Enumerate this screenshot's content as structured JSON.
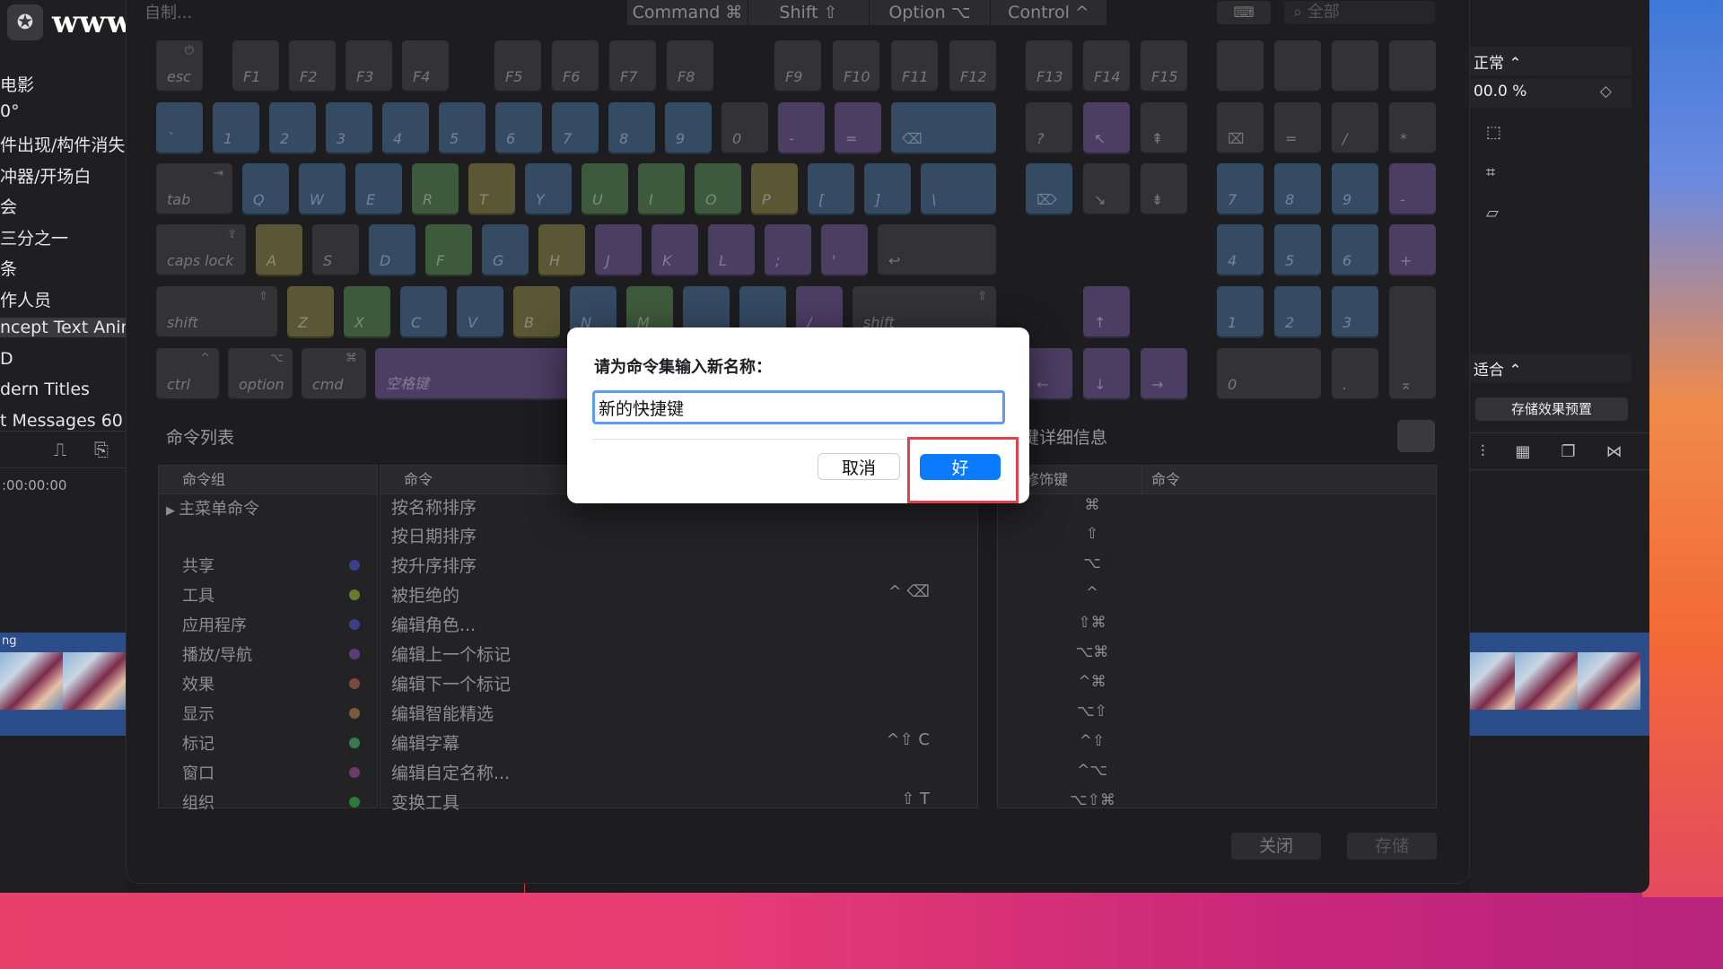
{
  "watermark": {
    "logo": "✪",
    "text": "www.MacW.com"
  },
  "left_panel": {
    "items": [
      "电影",
      "0°",
      "件出现/构件消失",
      "冲器/开场白",
      "会",
      "三分之一",
      "条",
      "作人员",
      "ncept Text Anim",
      "D",
      "dern Titles",
      "t Messages 60"
    ],
    "timecode": ":00:00:00",
    "clip_label": "ng"
  },
  "right_panel": {
    "blend_mode": "正常 ⌃",
    "opacity": "00.0 %",
    "fit": "适合 ⌃",
    "save_preset": "存储效果预置"
  },
  "topbar": {
    "set_selector": "自制...",
    "modifiers": [
      "Command ⌘",
      "Shift ⇧",
      "Option ⌥",
      "Control ^"
    ],
    "search_placeholder": "全部"
  },
  "keyboard": {
    "fn_row": [
      "esc",
      "F1",
      "F2",
      "F3",
      "F4",
      "F5",
      "F6",
      "F7",
      "F8",
      "F9",
      "F10",
      "F11",
      "F12",
      "F13",
      "F14",
      "F15"
    ],
    "num_row": [
      "`",
      "1",
      "2",
      "3",
      "4",
      "5",
      "6",
      "7",
      "8",
      "9",
      "0",
      "-",
      "=",
      "⌫"
    ],
    "qwerty_row": [
      "tab",
      "Q",
      "W",
      "E",
      "R",
      "T",
      "Y",
      "U",
      "I",
      "O",
      "P",
      "[",
      "]",
      "\\"
    ],
    "asdf_row": [
      "caps lock",
      "A",
      "S",
      "D",
      "F",
      "G",
      "H",
      "J",
      "K",
      "L",
      ";",
      "'",
      "↩"
    ],
    "zxcv_row": [
      "shift",
      "Z",
      "X",
      "C",
      "V",
      "B",
      "N",
      "M",
      "/",
      "shift"
    ],
    "bottom_row": [
      "ctrl",
      "option",
      "cmd",
      "空格键"
    ],
    "nav_keys": [
      "?",
      "↖",
      "⇞",
      "⌦",
      "↘",
      "⇟",
      "↑",
      "←",
      "↓",
      "→"
    ],
    "keypad": [
      "⌧",
      "=",
      "/",
      "*",
      "7",
      "8",
      "9",
      "-",
      "4",
      "5",
      "6",
      "+",
      "1",
      "2",
      "3",
      "0",
      ".",
      "⌅"
    ]
  },
  "command_list": {
    "title": "命令列表",
    "group_header": "命令组",
    "command_header": "命令",
    "groups": [
      {
        "label": "主菜单命令",
        "dot": ""
      },
      {
        "label": "共享",
        "dot": "#3b3f8a"
      },
      {
        "label": "工具",
        "dot": "#6b7a2a"
      },
      {
        "label": "应用程序",
        "dot": "#3b3f8a"
      },
      {
        "label": "播放/导航",
        "dot": "#5c3d7a"
      },
      {
        "label": "效果",
        "dot": "#7a4a3a"
      },
      {
        "label": "显示",
        "dot": "#7a5a3a"
      },
      {
        "label": "标记",
        "dot": "#3a7a4a"
      },
      {
        "label": "窗口",
        "dot": "#6a3a6a"
      },
      {
        "label": "组织",
        "dot": "#2a7a3a"
      }
    ],
    "commands": [
      {
        "label": "按名称排序",
        "shortcut": ""
      },
      {
        "label": "按日期排序",
        "shortcut": ""
      },
      {
        "label": "按升序排序",
        "shortcut": ""
      },
      {
        "label": "被拒绝的",
        "shortcut": "^   ⌫"
      },
      {
        "label": "编辑角色...",
        "shortcut": ""
      },
      {
        "label": "编辑上一个标记",
        "shortcut": ""
      },
      {
        "label": "编辑下一个标记",
        "shortcut": ""
      },
      {
        "label": "编辑智能精选",
        "shortcut": ""
      },
      {
        "label": "编辑字幕",
        "shortcut": "^⇧   C"
      },
      {
        "label": "编辑自定名称...",
        "shortcut": ""
      },
      {
        "label": "变换工具",
        "shortcut": "⇧   T"
      }
    ]
  },
  "key_details": {
    "title": "键详细信息",
    "modifier_header": "修饰键",
    "command_header": "命令",
    "modifiers": [
      "⌘",
      "⇧",
      "⌥",
      "^",
      "⇧⌘",
      "⌥⌘",
      "^⌘",
      "⌥⇧",
      "^⇧",
      "^⌥",
      "⌥⇧⌘"
    ]
  },
  "footer": {
    "close": "关闭",
    "save": "存储"
  },
  "dialog": {
    "prompt": "请为命令集输入新名称：",
    "value": "新的快捷键",
    "cancel": "取消",
    "ok": "好"
  }
}
